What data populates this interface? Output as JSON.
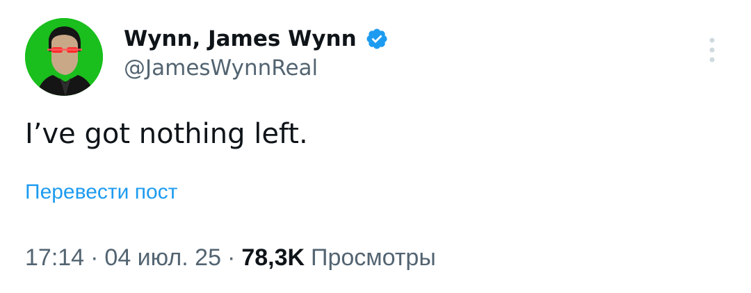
{
  "tweet": {
    "author": {
      "display_name": "Wynn, James Wynn",
      "handle": "@JamesWynnReal",
      "verified": true,
      "avatar": "avatar-image",
      "avatar_background": "#1fd21f"
    },
    "text": "I’ve got nothing left.",
    "translate_label": "Перевести пост",
    "meta": {
      "time": "17:14",
      "separator": "·",
      "date": "04 июл. 25",
      "views_count": "78,3K",
      "views_label": "Просмотры"
    }
  },
  "icons": {
    "verified": "verified-badge-icon",
    "more": "more-vertical-icon"
  },
  "colors": {
    "text_primary": "#0f1419",
    "text_secondary": "#536471",
    "link": "#1d9bf0",
    "verified": "#1d9bf0",
    "menu_dots": "#cfd9de"
  }
}
